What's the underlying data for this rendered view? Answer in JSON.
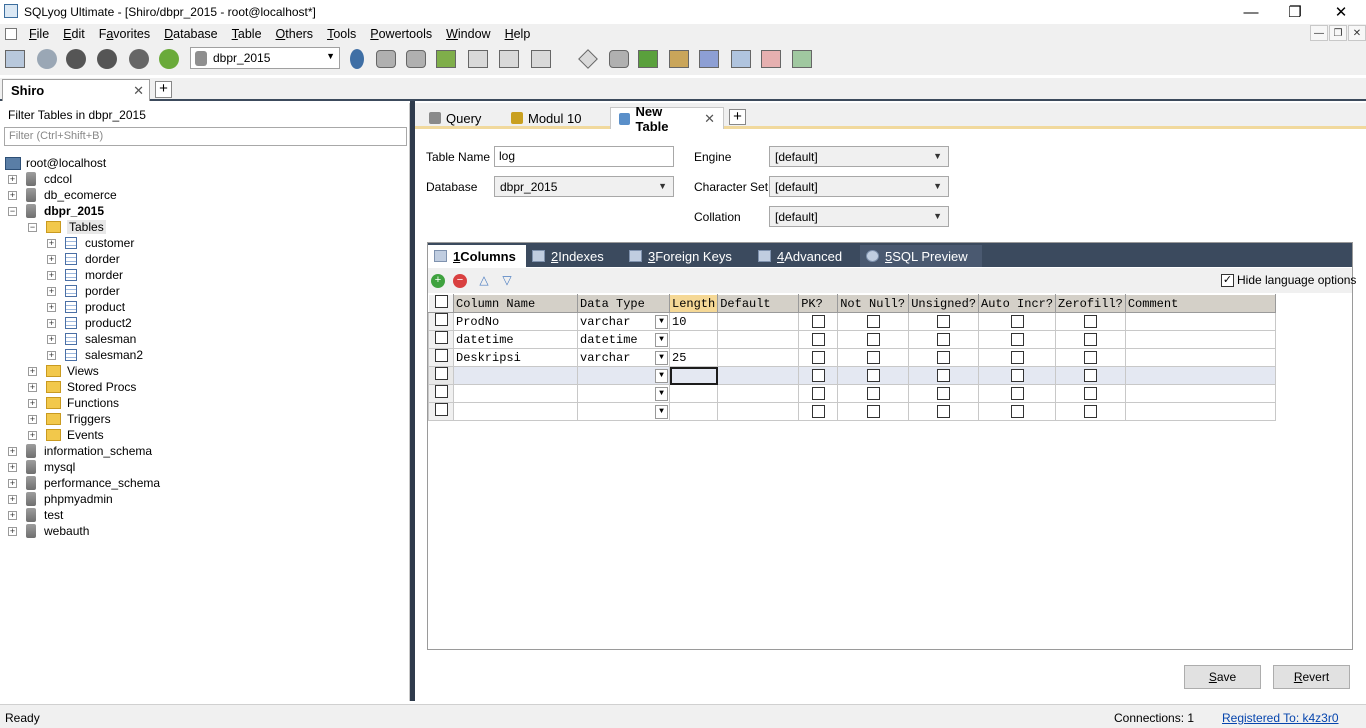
{
  "window": {
    "title": "SQLyog Ultimate - [Shiro/dbpr_2015 - root@localhost*]",
    "minimize": "—",
    "maximize": "❐",
    "close": "✕"
  },
  "menu": [
    {
      "label": "File",
      "u": "F",
      "rest": "ile"
    },
    {
      "label": "Edit",
      "u": "E",
      "rest": "dit"
    },
    {
      "label": "Favorites",
      "u": "a",
      "pre": "F",
      "rest": "vorites"
    },
    {
      "label": "Database",
      "u": "D",
      "rest": "atabase"
    },
    {
      "label": "Table",
      "u": "T",
      "rest": "able"
    },
    {
      "label": "Others",
      "u": "O",
      "rest": "thers"
    },
    {
      "label": "Tools",
      "u": "T",
      "rest": "ools"
    },
    {
      "label": "Powertools",
      "u": "P",
      "rest": "owertools"
    },
    {
      "label": "Window",
      "u": "W",
      "rest": "indow"
    },
    {
      "label": "Help",
      "u": "H",
      "rest": "elp"
    }
  ],
  "toolbar": {
    "db_select": "dbpr_2015"
  },
  "connection_tab": {
    "label": "Shiro",
    "close": "✕",
    "add": "+"
  },
  "left": {
    "filter_label": "Filter Tables in dbpr_2015",
    "filter_placeholder": "Filter (Ctrl+Shift+B)",
    "root": "root@localhost",
    "tree": [
      {
        "label": "cdcol"
      },
      {
        "label": "db_ecomerce"
      },
      {
        "label": "dbpr_2015",
        "bold": true,
        "expanded": true
      },
      {
        "label": "Tables",
        "expanded": true,
        "highlight": true
      },
      {
        "label": "customer"
      },
      {
        "label": "dorder"
      },
      {
        "label": "morder"
      },
      {
        "label": "porder"
      },
      {
        "label": "product"
      },
      {
        "label": "product2"
      },
      {
        "label": "salesman"
      },
      {
        "label": "salesman2"
      },
      {
        "label": "Views"
      },
      {
        "label": "Stored Procs"
      },
      {
        "label": "Functions"
      },
      {
        "label": "Triggers"
      },
      {
        "label": "Events"
      },
      {
        "label": "information_schema"
      },
      {
        "label": "mysql"
      },
      {
        "label": "performance_schema"
      },
      {
        "label": "phpmyadmin"
      },
      {
        "label": "test"
      },
      {
        "label": "webauth"
      }
    ]
  },
  "query_tabs": [
    {
      "label": "Query"
    },
    {
      "label": "Modul 10"
    },
    {
      "label": "New Table",
      "close": "✕"
    }
  ],
  "add_tab": "+",
  "form": {
    "table_name_label": "Table Name",
    "table_name_value": "log",
    "database_label": "Database",
    "database_value": "dbpr_2015",
    "engine_label": "Engine",
    "engine_value": "[default]",
    "charset_label": "Character Set",
    "charset_value": "[default]",
    "collation_label": "Collation",
    "collation_value": "[default]"
  },
  "sub_tabs": [
    {
      "num": "1",
      "label": " Columns"
    },
    {
      "num": "2",
      "label": " Indexes"
    },
    {
      "num": "3",
      "label": " Foreign Keys"
    },
    {
      "num": "4",
      "label": " Advanced"
    },
    {
      "num": "5",
      "label": " SQL Preview"
    }
  ],
  "hide_language_label": "Hide language options",
  "grid": {
    "headers": [
      "Column Name",
      "Data Type",
      "Length",
      "Default",
      "PK?",
      "Not Null?",
      "Unsigned?",
      "Auto Incr?",
      "Zerofill?",
      "Comment"
    ],
    "rows": [
      {
        "name": "ProdNo",
        "type": "varchar",
        "length": "10"
      },
      {
        "name": "datetime",
        "type": "datetime",
        "length": ""
      },
      {
        "name": "Deskripsi",
        "type": "varchar",
        "length": "25"
      },
      {
        "name": "",
        "type": "",
        "length": ""
      },
      {
        "name": "",
        "type": "",
        "length": ""
      },
      {
        "name": "",
        "type": "",
        "length": ""
      }
    ]
  },
  "buttons": {
    "save": "Save",
    "save_u": "S",
    "save_rest": "ave",
    "revert": "Revert",
    "revert_u": "R",
    "revert_rest": "evert"
  },
  "status": {
    "ready": "Ready",
    "connections": "Connections: 1",
    "registered": "Registered To: k4z3r0"
  }
}
